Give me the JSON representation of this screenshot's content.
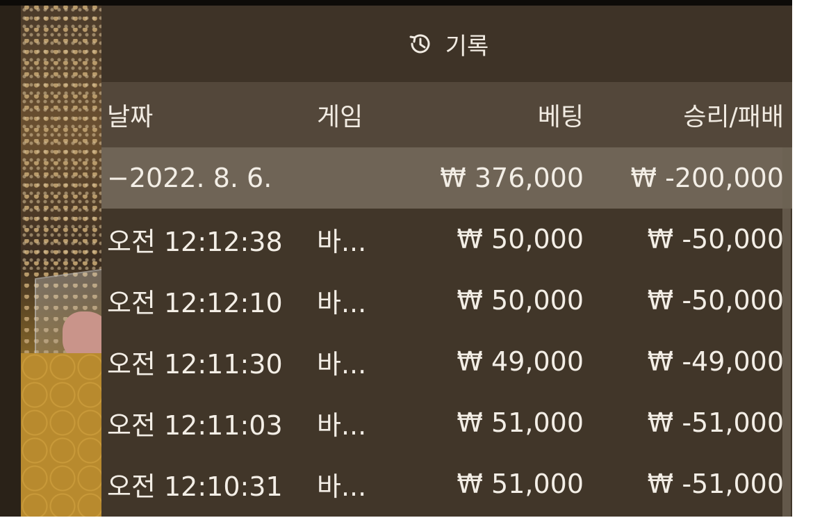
{
  "title": {
    "icon": "history-icon",
    "text": "기록"
  },
  "columns": {
    "date": "날짜",
    "game": "게임",
    "bet": "베팅",
    "win_loss": "승리/패배"
  },
  "summary": {
    "date": "−2022. 8. 6.",
    "bet": "₩ 376,000",
    "win_loss": "₩ -200,000"
  },
  "rows": [
    {
      "time": "오전 12:12:38",
      "game": "바...",
      "bet": "₩ 50,000",
      "win_loss": "₩ -50,000"
    },
    {
      "time": "오전 12:12:10",
      "game": "바...",
      "bet": "₩ 50,000",
      "win_loss": "₩ -50,000"
    },
    {
      "time": "오전 12:11:30",
      "game": "바...",
      "bet": "₩ 49,000",
      "win_loss": "₩ -49,000"
    },
    {
      "time": "오전 12:11:03",
      "game": "바...",
      "bet": "₩ 51,000",
      "win_loss": "₩ -51,000"
    },
    {
      "time": "오전 12:10:31",
      "game": "바...",
      "bet": "₩ 51,000",
      "win_loss": "₩ -51,000"
    }
  ],
  "colors": {
    "panel_bg": "#413629",
    "header_bg": "#53473a",
    "summary_bg": "#6f6456",
    "text": "#f1ebe2"
  }
}
